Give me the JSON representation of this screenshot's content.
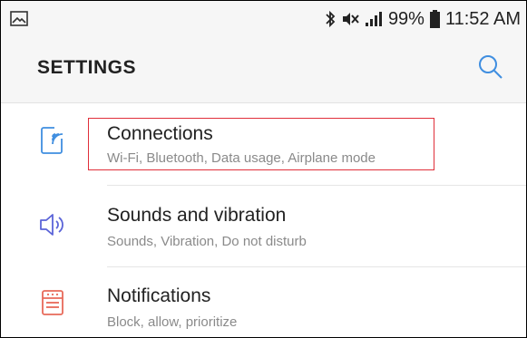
{
  "status_bar": {
    "battery": "99%",
    "time": "11:52 AM",
    "icons": [
      "image-icon",
      "bluetooth-icon",
      "mute-icon",
      "signal-icon",
      "battery-icon"
    ]
  },
  "header": {
    "title": "SETTINGS",
    "search_icon": "search-icon"
  },
  "items": [
    {
      "title": "Connections",
      "subtitle": "Wi-Fi, Bluetooth, Data usage, Airplane mode",
      "icon": "connections-icon",
      "highlighted": true
    },
    {
      "title": "Sounds and vibration",
      "subtitle": "Sounds, Vibration, Do not disturb",
      "icon": "speaker-icon",
      "highlighted": false
    },
    {
      "title": "Notifications",
      "subtitle": "Block, allow, prioritize",
      "icon": "notifications-icon",
      "highlighted": false
    }
  ],
  "colors": {
    "connections_icon": "#3f8ee0",
    "sounds_icon": "#5b64d8",
    "notifications_icon": "#e86a5a",
    "highlight": "#e02f3a",
    "search_icon": "#3f8ee0"
  }
}
